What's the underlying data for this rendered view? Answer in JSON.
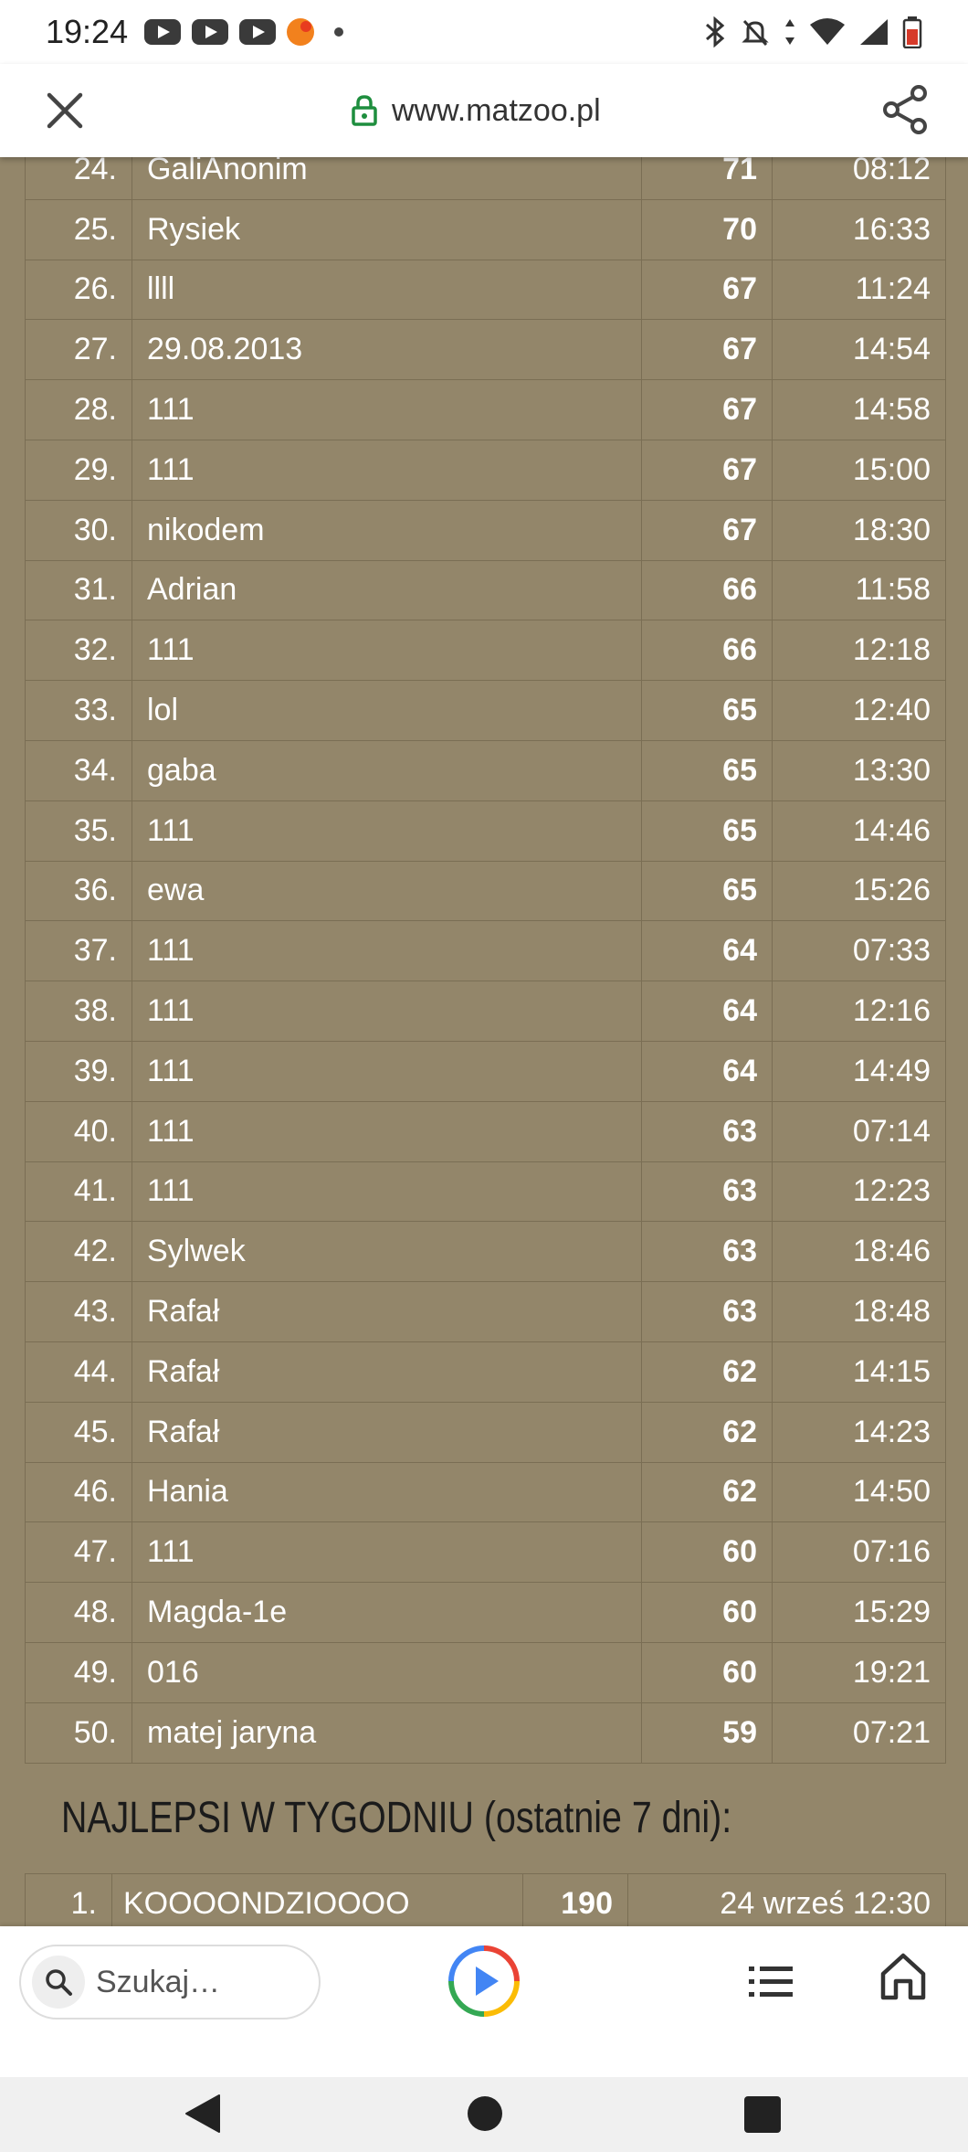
{
  "status": {
    "time": "19:24"
  },
  "browser": {
    "url": "www.matzoo.pl",
    "search_placeholder": "Szukaj…"
  },
  "leaderboard": {
    "rows": [
      {
        "rank": "24.",
        "name": "GaliAnonim",
        "score": "71",
        "time": "08:12"
      },
      {
        "rank": "25.",
        "name": "Rysiek",
        "score": "70",
        "time": "16:33"
      },
      {
        "rank": "26.",
        "name": "llll",
        "score": "67",
        "time": "11:24"
      },
      {
        "rank": "27.",
        "name": "29.08.2013",
        "score": "67",
        "time": "14:54"
      },
      {
        "rank": "28.",
        "name": "111",
        "score": "67",
        "time": "14:58"
      },
      {
        "rank": "29.",
        "name": "111",
        "score": "67",
        "time": "15:00"
      },
      {
        "rank": "30.",
        "name": "nikodem",
        "score": "67",
        "time": "18:30"
      },
      {
        "rank": "31.",
        "name": "Adrian",
        "score": "66",
        "time": "11:58"
      },
      {
        "rank": "32.",
        "name": "111",
        "score": "66",
        "time": "12:18"
      },
      {
        "rank": "33.",
        "name": "lol",
        "score": "65",
        "time": "12:40"
      },
      {
        "rank": "34.",
        "name": "gaba",
        "score": "65",
        "time": "13:30"
      },
      {
        "rank": "35.",
        "name": "111",
        "score": "65",
        "time": "14:46"
      },
      {
        "rank": "36.",
        "name": "ewa",
        "score": "65",
        "time": "15:26"
      },
      {
        "rank": "37.",
        "name": "111",
        "score": "64",
        "time": "07:33"
      },
      {
        "rank": "38.",
        "name": "111",
        "score": "64",
        "time": "12:16"
      },
      {
        "rank": "39.",
        "name": "111",
        "score": "64",
        "time": "14:49"
      },
      {
        "rank": "40.",
        "name": "111",
        "score": "63",
        "time": "07:14"
      },
      {
        "rank": "41.",
        "name": "111",
        "score": "63",
        "time": "12:23"
      },
      {
        "rank": "42.",
        "name": "Sylwek",
        "score": "63",
        "time": "18:46"
      },
      {
        "rank": "43.",
        "name": "Rafał",
        "score": "63",
        "time": "18:48"
      },
      {
        "rank": "44.",
        "name": "Rafał",
        "score": "62",
        "time": "14:15"
      },
      {
        "rank": "45.",
        "name": "Rafał",
        "score": "62",
        "time": "14:23"
      },
      {
        "rank": "46.",
        "name": "Hania",
        "score": "62",
        "time": "14:50"
      },
      {
        "rank": "47.",
        "name": "111",
        "score": "60",
        "time": "07:16"
      },
      {
        "rank": "48.",
        "name": "Magda-1e",
        "score": "60",
        "time": "15:29"
      },
      {
        "rank": "49.",
        "name": "016",
        "score": "60",
        "time": "19:21"
      },
      {
        "rank": "50.",
        "name": "matej jaryna",
        "score": "59",
        "time": "07:21"
      }
    ]
  },
  "weekly": {
    "heading": "NAJLEPSI W TYGODNIU (ostatnie 7 dni):",
    "rows": [
      {
        "rank": "1.",
        "name": "KOOOONDZIOOOO",
        "score": "190",
        "date": "24 wrześ 12:30"
      }
    ]
  }
}
